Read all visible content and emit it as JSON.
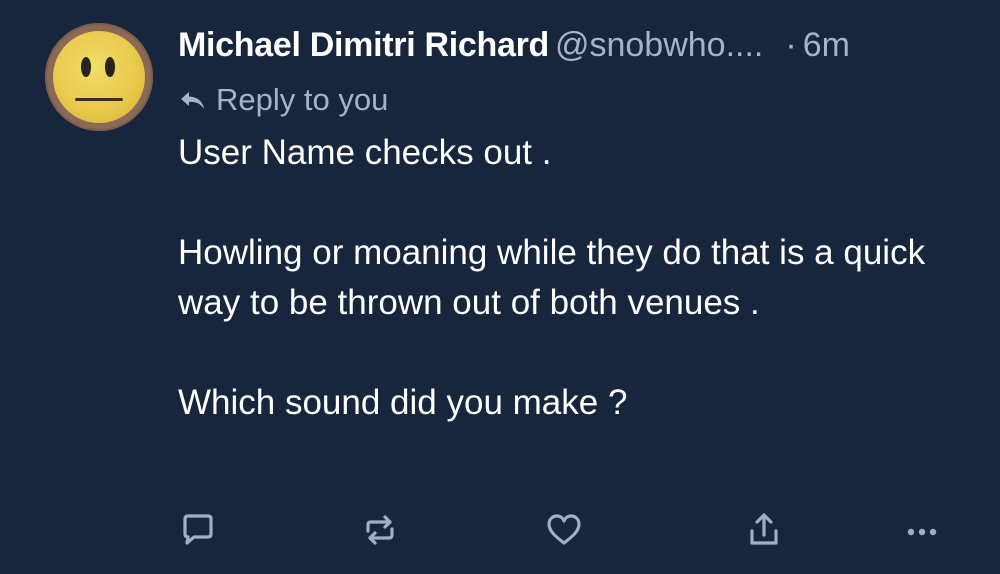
{
  "author": {
    "display_name": "Michael Dimitri Richard",
    "handle": "@snobwho....",
    "separator": "·",
    "time": "6m",
    "avatar_icon": "neutral-face-emoji"
  },
  "reply_context": {
    "label": "Reply to you",
    "icon": "reply-arrow-icon"
  },
  "post": {
    "paragraphs": [
      "User Name checks out .",
      "Howling or moaning while they do that is a quick way to be thrown out of both venues .",
      "Which sound did you make ?"
    ]
  },
  "actions": [
    {
      "name": "comment",
      "icon": "comment-icon"
    },
    {
      "name": "repost",
      "icon": "repost-icon"
    },
    {
      "name": "like",
      "icon": "heart-icon"
    },
    {
      "name": "share",
      "icon": "share-icon"
    },
    {
      "name": "more",
      "icon": "more-icon"
    }
  ],
  "colors": {
    "background": "#18263d",
    "text_primary": "#ffffff",
    "text_secondary": "#a4b3c7",
    "icon": "#9fb0c6"
  }
}
